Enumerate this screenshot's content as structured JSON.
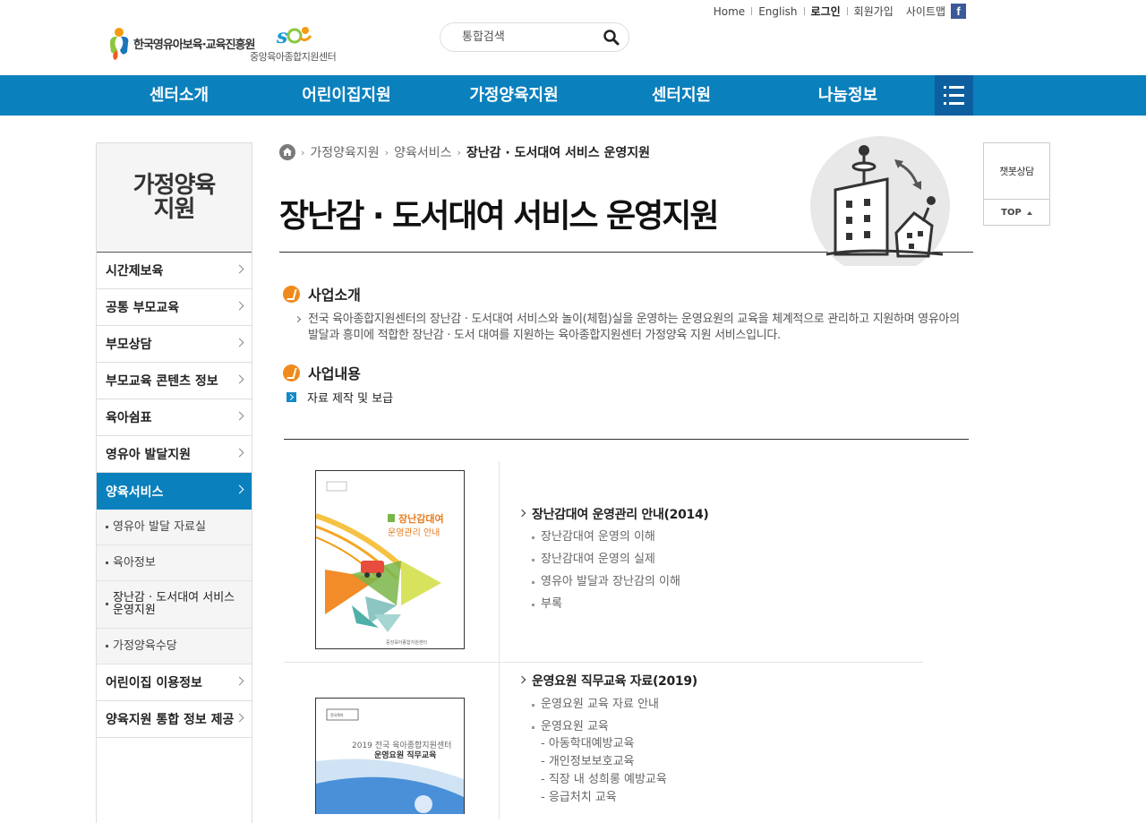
{
  "top_util": {
    "home": "Home",
    "english": "English",
    "login": "로그인",
    "join": "회원가입",
    "sitemap": "사이트맵",
    "facebook": "f"
  },
  "logos": {
    "kcpi": "한국영유아보육·교육진흥원",
    "center": "중앙육아종합지원센터"
  },
  "search": {
    "placeholder": "통합검색",
    "icon": "search-icon"
  },
  "gnb": [
    "센터소개",
    "어린이집지원",
    "가정양육지원",
    "센터지원",
    "나눔정보"
  ],
  "lnb": {
    "title": "가정양육 지원",
    "items": [
      "시간제보육",
      "공통 부모교육",
      "부모상담",
      "부모교육 콘텐츠 정보",
      "육아쉼표",
      "영유아 발달지원",
      "양육서비스"
    ],
    "subitems": [
      "영유아 발달 자료실",
      "육아정보",
      "장난감 · 도서대여 서비스 운영지원",
      "가정양육수당"
    ],
    "items_after": [
      "어린이집 이용정보",
      "양육지원 통합 정보 제공"
    ]
  },
  "breadcrumb": [
    "가정양육지원",
    "양육서비스",
    "장난감 · 도서대여 서비스 운영지원"
  ],
  "page_title": "장난감 · 도서대여 서비스 운영지원",
  "intro": {
    "heading": "사업소개",
    "text": "전국 육아종합지원센터의 장난감 · 도서대여 서비스와 놀이(체험)실을 운영하는 운영요원의 교육을 체계적으로 관리하고 지원하며 영유아의 발달과 흥미에 적합한 장난감 · 도서 대여를 지원하는 육아종합지원센터 가정양육 지원 서비스입니다."
  },
  "content": {
    "heading": "사업내용",
    "item": "자료 제작 및 보급"
  },
  "resources": [
    {
      "title": "장난감대여 운영관리 안내(2014)",
      "cover": {
        "line1": "장난감대여",
        "line2": "운영관리 안내"
      },
      "items": [
        "장난감대여 운영의 이해",
        "장난감대여 운영의 실제",
        "영유아 발달과 장난감의 이해",
        "부록"
      ]
    },
    {
      "title": "운영요원 직무교육 자료(2019)",
      "cover": {
        "line1": "2019 전국 육아종합지원센터",
        "line2": "운영요원 직무교육"
      },
      "items": [
        "운영요원 교육 자료 안내",
        "운영요원 교육"
      ],
      "subitems": [
        "- 아동학대예방교육",
        "- 개인정보보호교육",
        "- 직장 내 성희롱 예방교육",
        "- 응급처치 교육"
      ]
    }
  ],
  "quick": {
    "chat": "챗봇상담",
    "top": "TOP"
  },
  "colors": {
    "primary": "#0a80bd",
    "all_menu": "#0d5fa0",
    "accent": "#f08a1c"
  }
}
